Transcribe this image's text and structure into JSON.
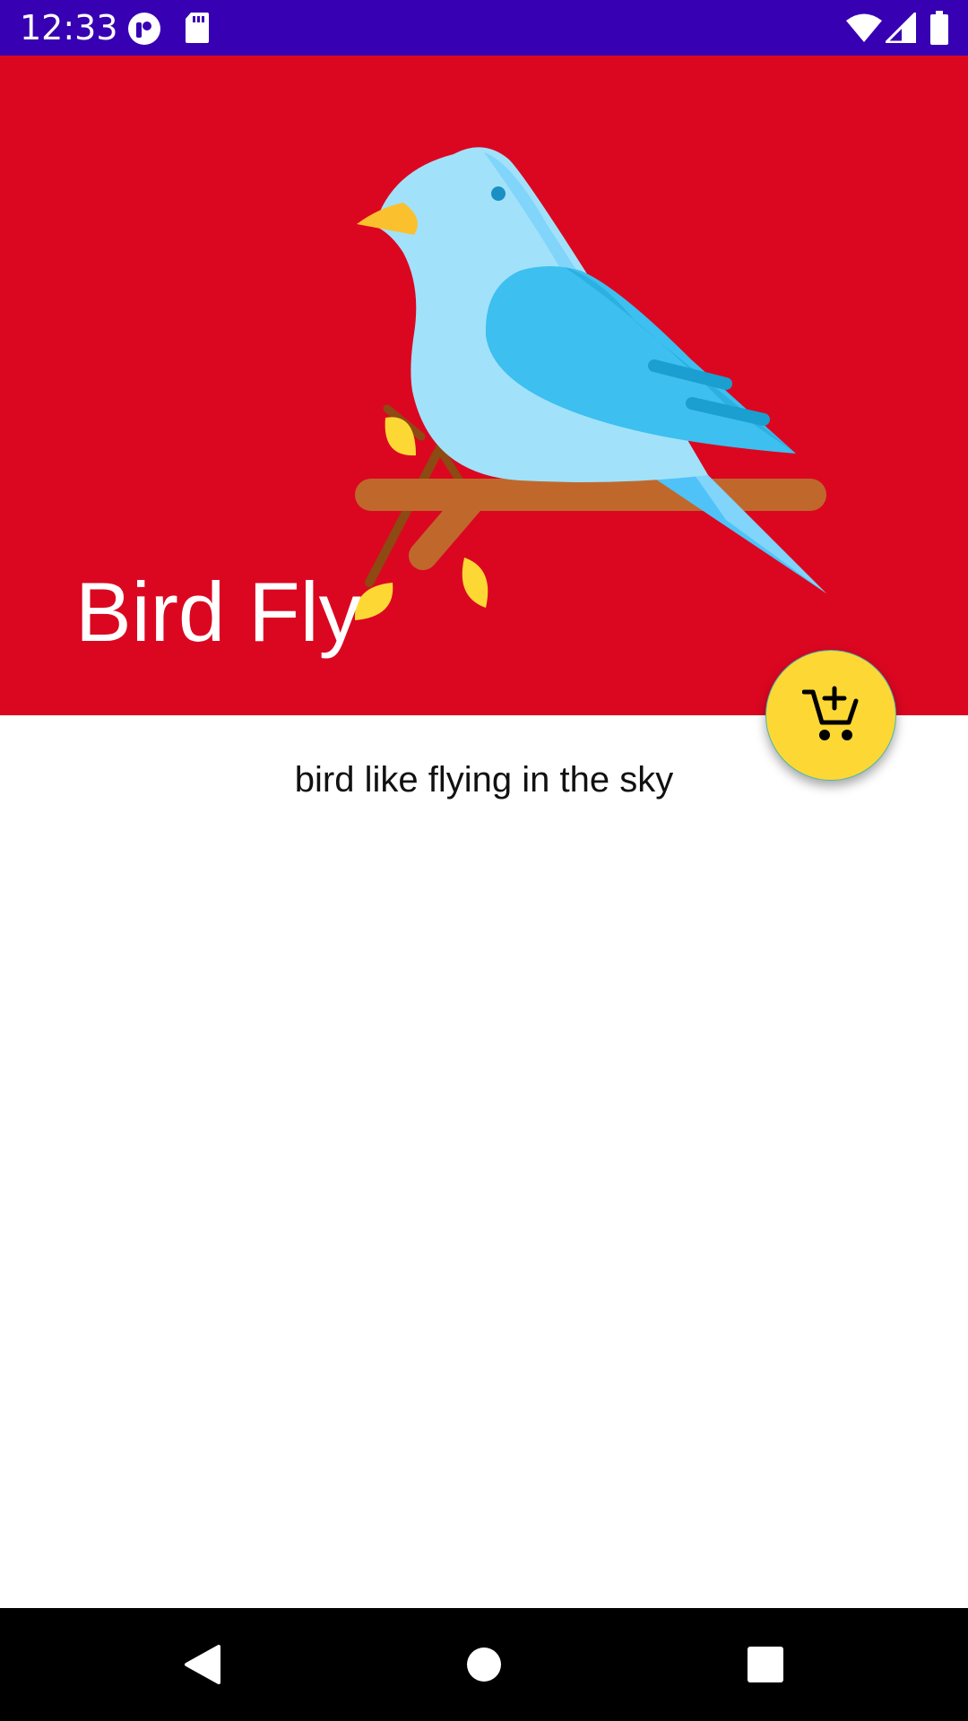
{
  "status_bar": {
    "time": "12:33",
    "icons": [
      "notification-app-icon",
      "sd-card-icon",
      "wifi-icon",
      "cellular-signal-icon",
      "battery-icon"
    ],
    "background_color": "#3700b3"
  },
  "hero": {
    "title": "Bird Fly",
    "background_color": "#db0721",
    "illustration": "bird-on-branch-illustration"
  },
  "content": {
    "subtitle": "bird like flying in the sky"
  },
  "fab": {
    "icon": "add-to-cart-icon",
    "color": "#fdd835"
  },
  "nav_bar": {
    "buttons": [
      "back-icon",
      "home-icon",
      "recents-icon"
    ]
  }
}
